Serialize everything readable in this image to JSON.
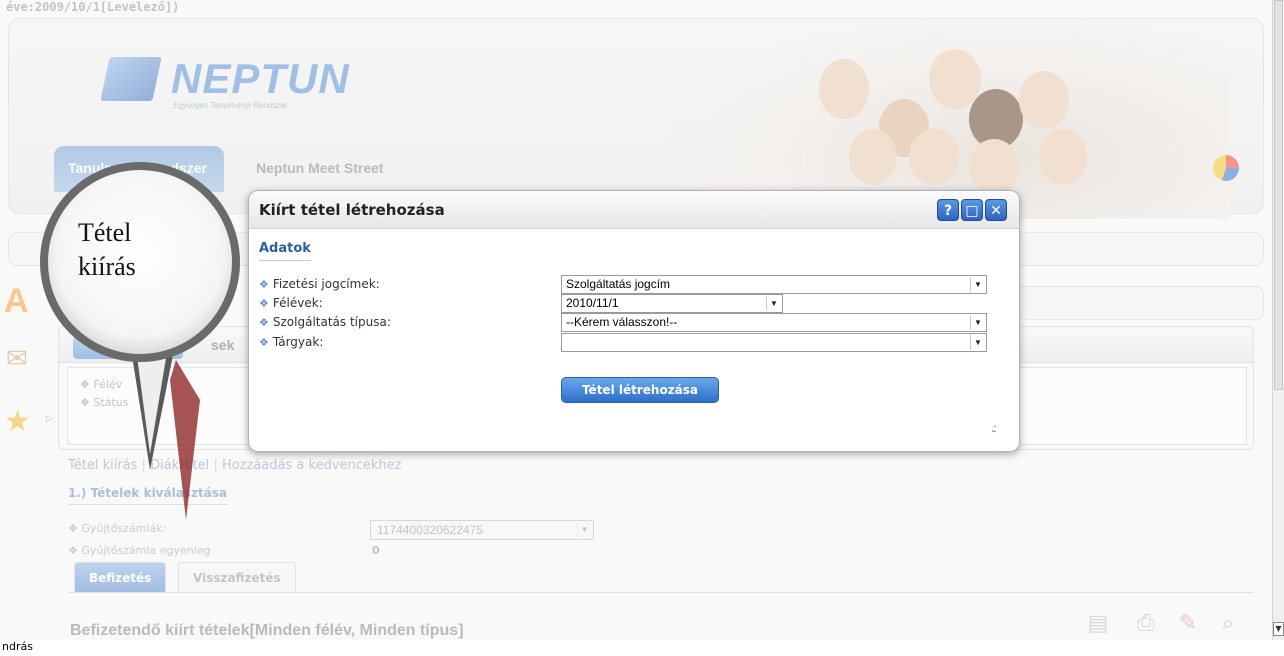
{
  "page": {
    "top_status": "éve:2009/10/1[Levelező])",
    "logo": {
      "text": "NEPTUN",
      "subtitle": "Egységes Tanulmányi Rendszer"
    },
    "nav_tabs": [
      {
        "label": "Tanulmányi rendszer"
      },
      {
        "label": "Neptun Meet Street"
      }
    ],
    "panel_tab_partial": "sek",
    "filter_partial": {
      "felev": "Félév",
      "status": "Státus"
    },
    "links": {
      "item1": "Tétel kiírás",
      "item2": "DiákHitel",
      "item3": "Hozzáadás a kedvencekhez",
      "separator": "|"
    },
    "section1_title": "1.) Tételek kiválasztása",
    "gyujto": {
      "label": "Gyűjtőszámlák:",
      "value": "1174400320622475"
    },
    "gyujto_egyenleg": {
      "label": "Gyűjtőszámla egyenleg",
      "value": "0"
    },
    "payment_tabs": [
      {
        "label": "Befizetés"
      },
      {
        "label": "Visszafizetés"
      }
    ],
    "bottom_title": "Befizetendő kiírt tételek[Minden félév, Minden típus]",
    "status_bar": "ndrás"
  },
  "callout": {
    "line1": "Tétel",
    "line2": "kiírás"
  },
  "modal": {
    "title": "Kiírt tétel létrehozása",
    "section": "Adatok",
    "fields": [
      {
        "label": "Fizetési jogcímek:",
        "value": "Szolgáltatás jogcím"
      },
      {
        "label": "Félévek:",
        "value": "2010/11/1"
      },
      {
        "label": "Szolgáltatás típusa:",
        "value": "--Kérem válasszon!--"
      },
      {
        "label": "Tárgyak:",
        "value": ""
      }
    ],
    "button_label": "Tétel létrehozása",
    "window_buttons": {
      "help": "?",
      "maximize": "□",
      "close": "✕"
    }
  },
  "colors": {
    "accent": "#2d6fc8",
    "link": "#2c5f9e"
  }
}
